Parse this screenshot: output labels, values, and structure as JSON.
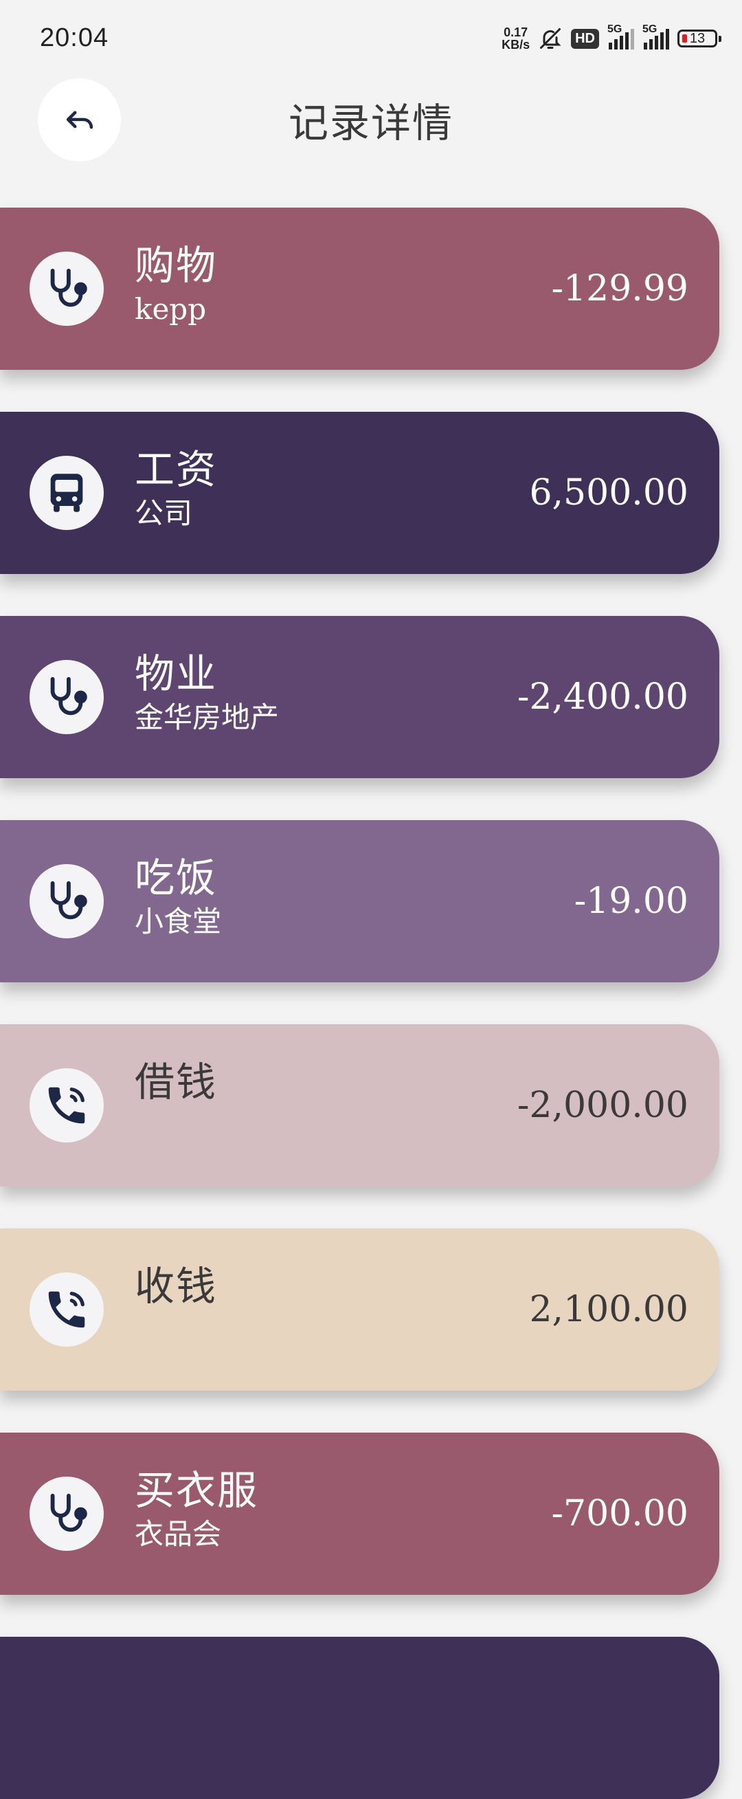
{
  "status_bar": {
    "time": "20:04",
    "net_speed_value": "0.17",
    "net_speed_unit": "KB/s",
    "hd_badge": "HD",
    "sim1_label": "5G",
    "sim2_label": "5G",
    "battery_level": "13",
    "icons": [
      "bell-off-icon",
      "hd-icon",
      "signal-icon",
      "signal-icon",
      "battery-icon"
    ]
  },
  "header": {
    "title": "记录详情",
    "back_icon": "back-arrow-icon"
  },
  "colors": {
    "background": "#f3f3f3",
    "icon_dark": "#1d2748"
  },
  "records": [
    {
      "title": "购物",
      "subtitle": "kepp",
      "amount": "-129.99",
      "icon": "stethoscope-icon",
      "color": "#9a5a6e",
      "text_color": "#ffffff"
    },
    {
      "title": "工资",
      "subtitle": "公司",
      "amount": "6,500.00",
      "icon": "bus-icon",
      "color": "#3e3056",
      "text_color": "#ffffff"
    },
    {
      "title": "物业",
      "subtitle": "金华房地产",
      "amount": "-2,400.00",
      "icon": "stethoscope-icon",
      "color": "#5e4670",
      "text_color": "#ffffff"
    },
    {
      "title": "吃饭",
      "subtitle": "小食堂",
      "amount": "-19.00",
      "icon": "stethoscope-icon",
      "color": "#82688f",
      "text_color": "#ffffff"
    },
    {
      "title": "借钱",
      "subtitle": "",
      "amount": "-2,000.00",
      "icon": "phone-call-icon",
      "color": "#d5bec2",
      "text_color": "#3a3a3a"
    },
    {
      "title": "收钱",
      "subtitle": "",
      "amount": "2,100.00",
      "icon": "phone-call-icon",
      "color": "#e8d5bf",
      "text_color": "#3a3a3a"
    },
    {
      "title": "买衣服",
      "subtitle": "衣品会",
      "amount": "-700.00",
      "icon": "stethoscope-icon",
      "color": "#9a5a6e",
      "text_color": "#ffffff"
    },
    {
      "title": "",
      "subtitle": "",
      "amount": "",
      "icon": "",
      "color": "#3e3056",
      "text_color": "#ffffff"
    }
  ]
}
